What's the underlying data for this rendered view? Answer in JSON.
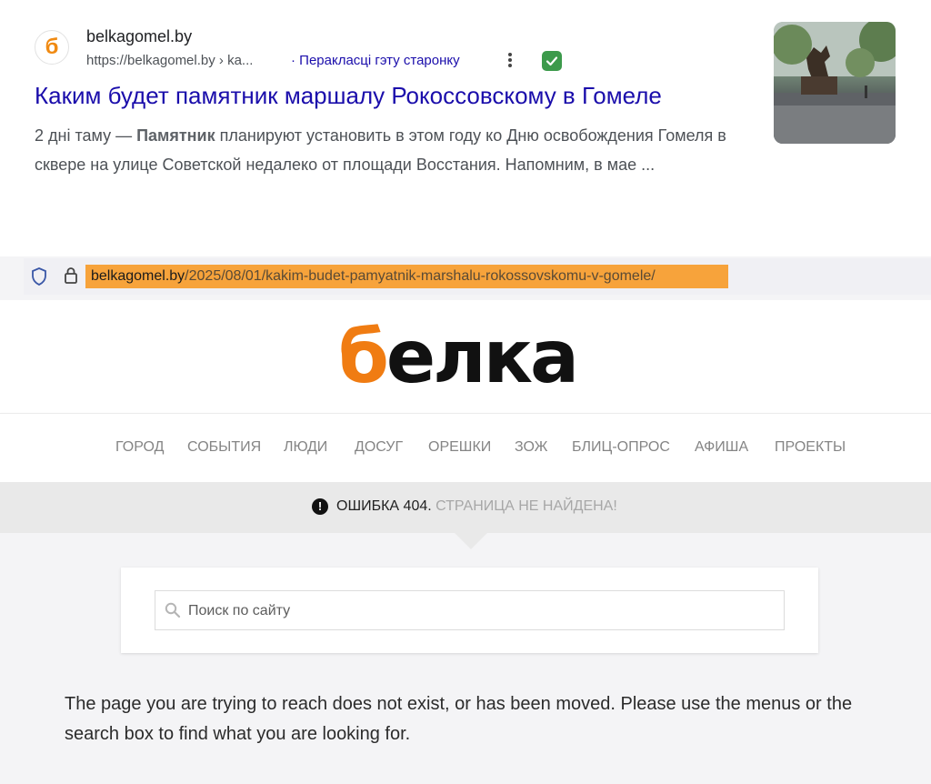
{
  "search_result": {
    "favicon_letter": "б",
    "site_name": "belkagomel.by",
    "url": "https://belkagomel.by › ka...",
    "translate_link": "· Перакласці гэту старонку",
    "title": "Каким будет памятник маршалу Рокоссовскому в Гомеле",
    "snippet": {
      "date": "2 дні таму — ",
      "bold": "Памятник",
      "rest": " планируют установить в этом году ко Дню освобождения Гомеля в сквере на улице Советской недалеко от площади Восстания. Напомним, в мае ..."
    }
  },
  "browser": {
    "url_host": "belkagomel.by",
    "url_path": "/2025/08/01/kakim-budet-pamyatnik-marshalu-rokossovskomu-v-gomele/",
    "highlight_color": "#f7a33b"
  },
  "site": {
    "logo_b": "б",
    "logo_rest": "елка",
    "brand_color": "#f07c12",
    "nav": [
      "ГОРОД",
      "СОБЫТИЯ",
      "ЛЮДИ",
      "ДОСУГ",
      "ОРЕШКИ",
      "ЗОЖ",
      "БЛИЦ-ОПРОС",
      "АФИША",
      "ПРОЕКТЫ"
    ],
    "error_icon": "!",
    "error_code": "ОШИБКА 404.",
    "error_text": " СТРАНИЦА НЕ НАЙДЕНА!",
    "search_placeholder": "Поиск по сайту",
    "message": "The page you are trying to reach does not exist, or has been moved. Please use the menus or the search box to find what you are looking for."
  }
}
